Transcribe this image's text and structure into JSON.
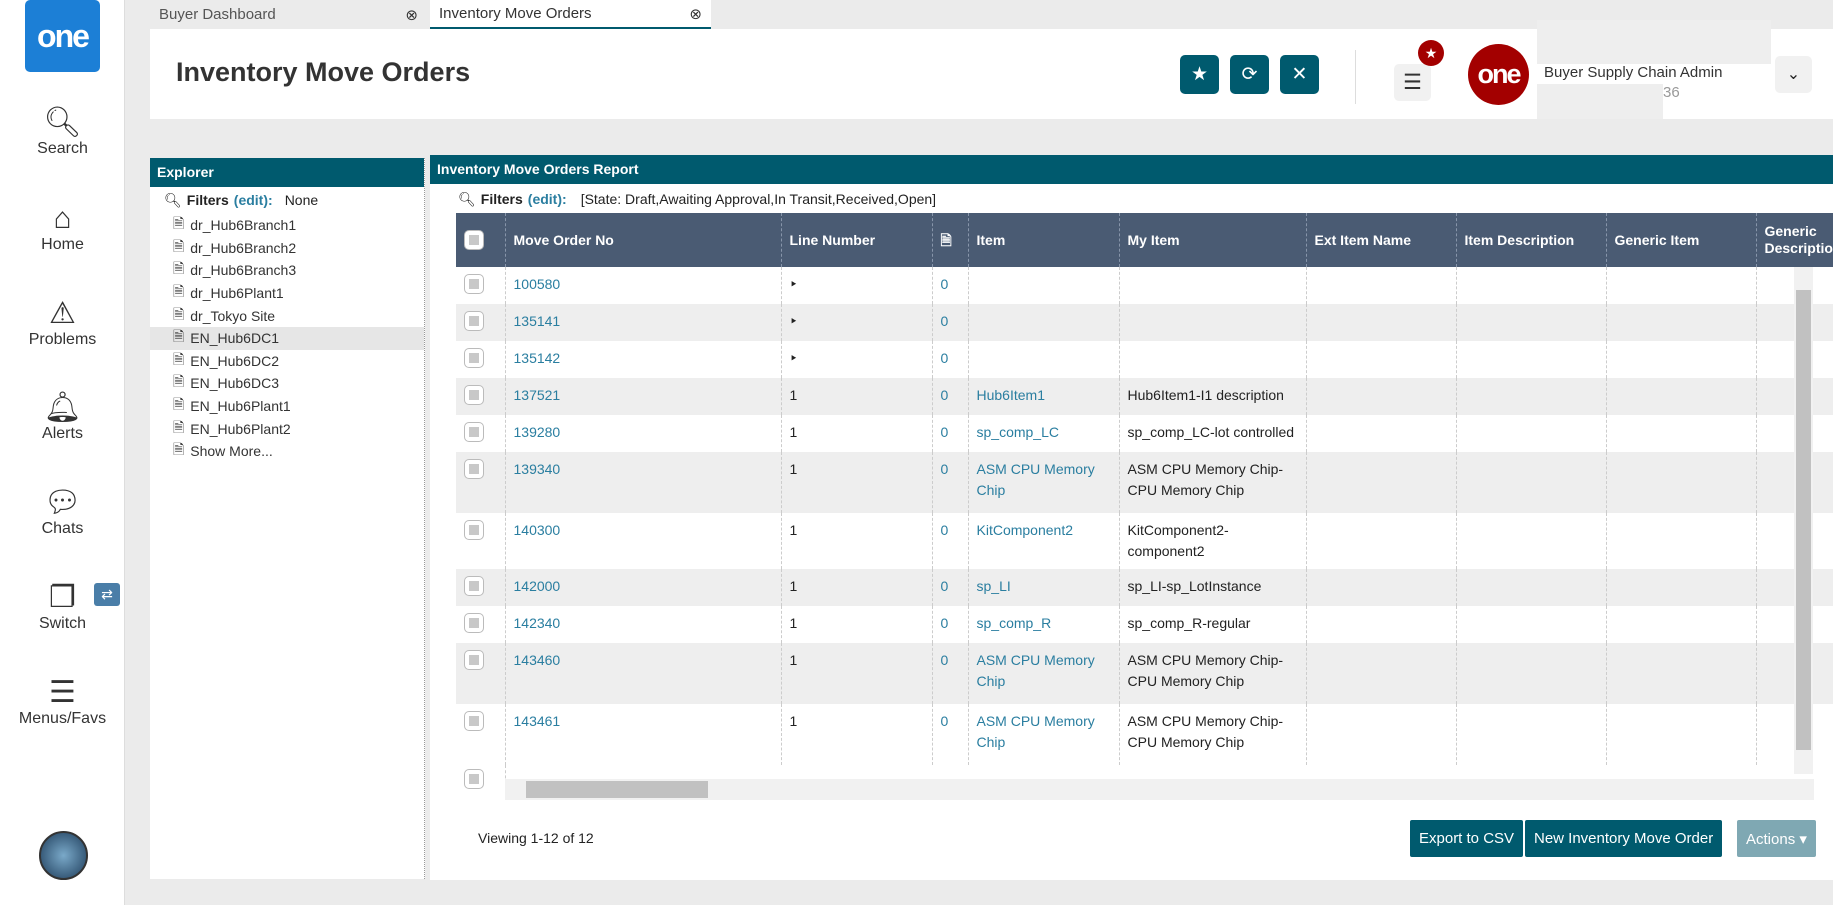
{
  "logo": "one",
  "sidebar": {
    "items": [
      {
        "label": "Search",
        "icon": "search-icon"
      },
      {
        "label": "Home",
        "icon": "home-icon"
      },
      {
        "label": "Problems",
        "icon": "warning-icon"
      },
      {
        "label": "Alerts",
        "icon": "bell-icon"
      },
      {
        "label": "Chats",
        "icon": "chat-icon"
      },
      {
        "label": "Switch",
        "icon": "switch-icon"
      },
      {
        "label": "Menus/Favs",
        "icon": "menu-icon"
      }
    ]
  },
  "tabs": [
    {
      "label": "Buyer Dashboard",
      "active": false
    },
    {
      "label": "Inventory Move Orders",
      "active": true
    }
  ],
  "header": {
    "title": "Inventory Move Orders",
    "user_role": "Buyer Supply Chain Admin",
    "user_name": "",
    "user_suffix": "36"
  },
  "explorer": {
    "title": "Explorer",
    "filters_label": "Filters",
    "edit": "(edit):",
    "filters_value": "None",
    "items": [
      "dr_Hub6Branch1",
      "dr_Hub6Branch2",
      "dr_Hub6Branch3",
      "dr_Hub6Plant1",
      "dr_Tokyo Site",
      "EN_Hub6DC1",
      "EN_Hub6DC2",
      "EN_Hub6DC3",
      "EN_Hub6Plant1",
      "EN_Hub6Plant2",
      "Show More..."
    ],
    "selected": "EN_Hub6DC1"
  },
  "report": {
    "title": "Inventory Move Orders Report",
    "filters_label": "Filters",
    "edit": "(edit):",
    "filters_value": "[State: Draft,Awaiting Approval,In Transit,Received,Open]",
    "columns": [
      "Move Order No",
      "Line Number",
      "",
      "Item",
      "My Item",
      "Ext Item Name",
      "Item Description",
      "Generic Item",
      "Generic Description"
    ],
    "rows": [
      [
        "100580",
        "‣",
        "0",
        "",
        ""
      ],
      [
        "135141",
        "‣",
        "0",
        "",
        ""
      ],
      [
        "135142",
        "‣",
        "0",
        "",
        ""
      ],
      [
        "137521",
        "1",
        "0",
        "Hub6Item1",
        "Hub6Item1-I1 description"
      ],
      [
        "139280",
        "1",
        "0",
        "sp_comp_LC",
        "sp_comp_LC-lot controlled"
      ],
      [
        "139340",
        "1",
        "0",
        "ASM CPU Memory Chip",
        "ASM CPU Memory Chip-CPU Memory Chip"
      ],
      [
        "140300",
        "1",
        "0",
        "KitComponent2",
        "KitComponent2-component2"
      ],
      [
        "142000",
        "1",
        "0",
        "sp_LI",
        "sp_LI-sp_LotInstance"
      ],
      [
        "142340",
        "1",
        "0",
        "sp_comp_R",
        "sp_comp_R-regular"
      ],
      [
        "143460",
        "1",
        "0",
        "ASM CPU Memory Chip",
        "ASM CPU Memory Chip-CPU Memory Chip"
      ],
      [
        "143461",
        "1",
        "0",
        "ASM CPU Memory Chip",
        "ASM CPU Memory Chip-CPU Memory Chip"
      ]
    ],
    "viewing": "Viewing 1-12 of 12",
    "export": "Export to CSV",
    "new": "New Inventory Move Order",
    "actions": "Actions ▾"
  },
  "colors": {
    "accent": "#005a6e",
    "table_header": "#4a5b73",
    "brand_red": "#a30000"
  }
}
